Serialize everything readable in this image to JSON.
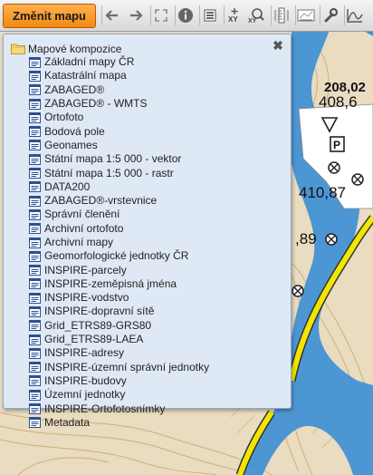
{
  "toolbar": {
    "change_map_label": "Změnit mapu",
    "tools": [
      {
        "icon": "arrow-left-icon"
      },
      {
        "icon": "arrow-right-icon"
      },
      {
        "icon": "fullscreen-icon"
      },
      {
        "icon": "info-icon"
      },
      {
        "icon": "list-icon"
      },
      {
        "icon": "coordinates-xy-icon"
      },
      {
        "icon": "zoom-xy-icon"
      },
      {
        "icon": "measure-icon"
      },
      {
        "icon": "print-icon"
      },
      {
        "icon": "wrench-icon"
      },
      {
        "icon": "profile-chart-icon"
      }
    ]
  },
  "panel": {
    "root_label": "Mapové kompozice",
    "close_icon": "close-icon",
    "items": [
      "Základní mapy ČR",
      "Katastrální mapa",
      "ZABAGED®",
      "ZABAGED® - WMTS",
      "Ortofoto",
      "Bodová pole",
      "Geonames",
      "Státní mapa 1:5 000 - vektor",
      "Státní mapa 1:5 000 - rastr",
      "DATA200",
      "ZABAGED®-vrstevnice",
      "Správní členění",
      "Archivní ortofoto",
      "Archivní mapy",
      "Geomorfologické jednotky ČR",
      "INSPIRE-parcely",
      "INSPIRE-zeměpisná jména",
      "INSPIRE-vodstvo",
      "INSPIRE-dopravní sítě",
      "Grid_ETRS89-GRS80",
      "Grid_ETRS89-LAEA",
      "INSPIRE-adresy",
      "INSPIRE-územní správní jednotky",
      "INSPIRE-budovy",
      "Územní jednotky",
      "INSPIRE-Ortofotosnímky",
      "Metadata"
    ]
  },
  "map": {
    "labels": [
      "208,02",
      "408,6",
      "410,87",
      ",89",
      "P"
    ],
    "colors": {
      "terrain": "#e9dcc0",
      "water": "#3f8fd6",
      "road": "#f2e600",
      "contour": "#c8a46a"
    }
  }
}
